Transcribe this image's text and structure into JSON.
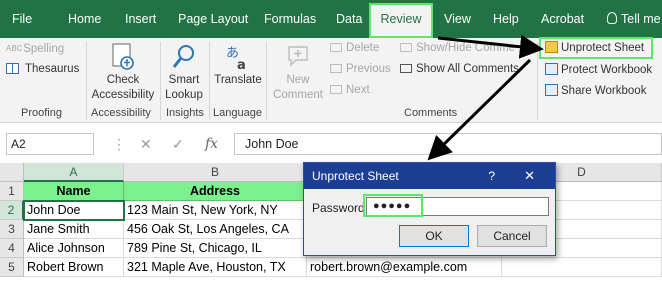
{
  "tabs": [
    {
      "label": "File"
    },
    {
      "label": "Home"
    },
    {
      "label": "Insert"
    },
    {
      "label": "Page Layout"
    },
    {
      "label": "Formulas"
    },
    {
      "label": "Data"
    },
    {
      "label": "Review",
      "active": true
    },
    {
      "label": "View"
    },
    {
      "label": "Help"
    },
    {
      "label": "Acrobat"
    },
    {
      "label": "Tell me"
    }
  ],
  "ribbon": {
    "proofing": {
      "spelling": "Spelling",
      "thesaurus": "Thesaurus",
      "group": "Proofing"
    },
    "accessibility": {
      "check_line1": "Check",
      "check_line2": "Accessibility",
      "group": "Accessibility"
    },
    "insights": {
      "smart_line1": "Smart",
      "smart_line2": "Lookup",
      "group": "Insights"
    },
    "language": {
      "translate": "Translate",
      "group": "Language"
    },
    "comments": {
      "new_line1": "New",
      "new_line2": "Comment",
      "delete": "Delete",
      "previous": "Previous",
      "next": "Next",
      "show_hide": "Show/Hide Comme",
      "show_all": "Show All Comments",
      "group": "Comments"
    },
    "protect": {
      "unprotect_sheet": "Unprotect Sheet",
      "protect_workbook": "Protect Workbook",
      "share_workbook": "Share Workbook"
    }
  },
  "formula_bar": {
    "name_box": "A2",
    "fx": "fx",
    "content": "John Doe",
    "cancel": "✕",
    "enter": "✓",
    "more": "⋮"
  },
  "columns": [
    "A",
    "B",
    "C",
    "D"
  ],
  "rows": [
    "1",
    "2",
    "3",
    "4",
    "5"
  ],
  "cells": {
    "a1": "Name",
    "b1": "Address",
    "a2": "John Doe",
    "b2": "123 Main St, New York, NY",
    "a3": "Jane Smith",
    "b3": "456 Oak St, Los Angeles, CA",
    "a4": "Alice Johnson",
    "b4": "789 Pine St, Chicago, IL",
    "a5": "Robert Brown",
    "b5": "321 Maple Ave, Houston, TX",
    "c5": "robert.brown@example.com"
  },
  "dialog": {
    "title": "Unprotect Sheet",
    "help": "?",
    "close": "✕",
    "password_label": "Password:",
    "password_value": "●●●●●",
    "ok": "OK",
    "cancel": "Cancel"
  },
  "colors": {
    "excel_green": "#217346",
    "highlight": "#5ee66a",
    "header_fill": "#7bf08c",
    "dialog_title": "#1c3f94"
  }
}
